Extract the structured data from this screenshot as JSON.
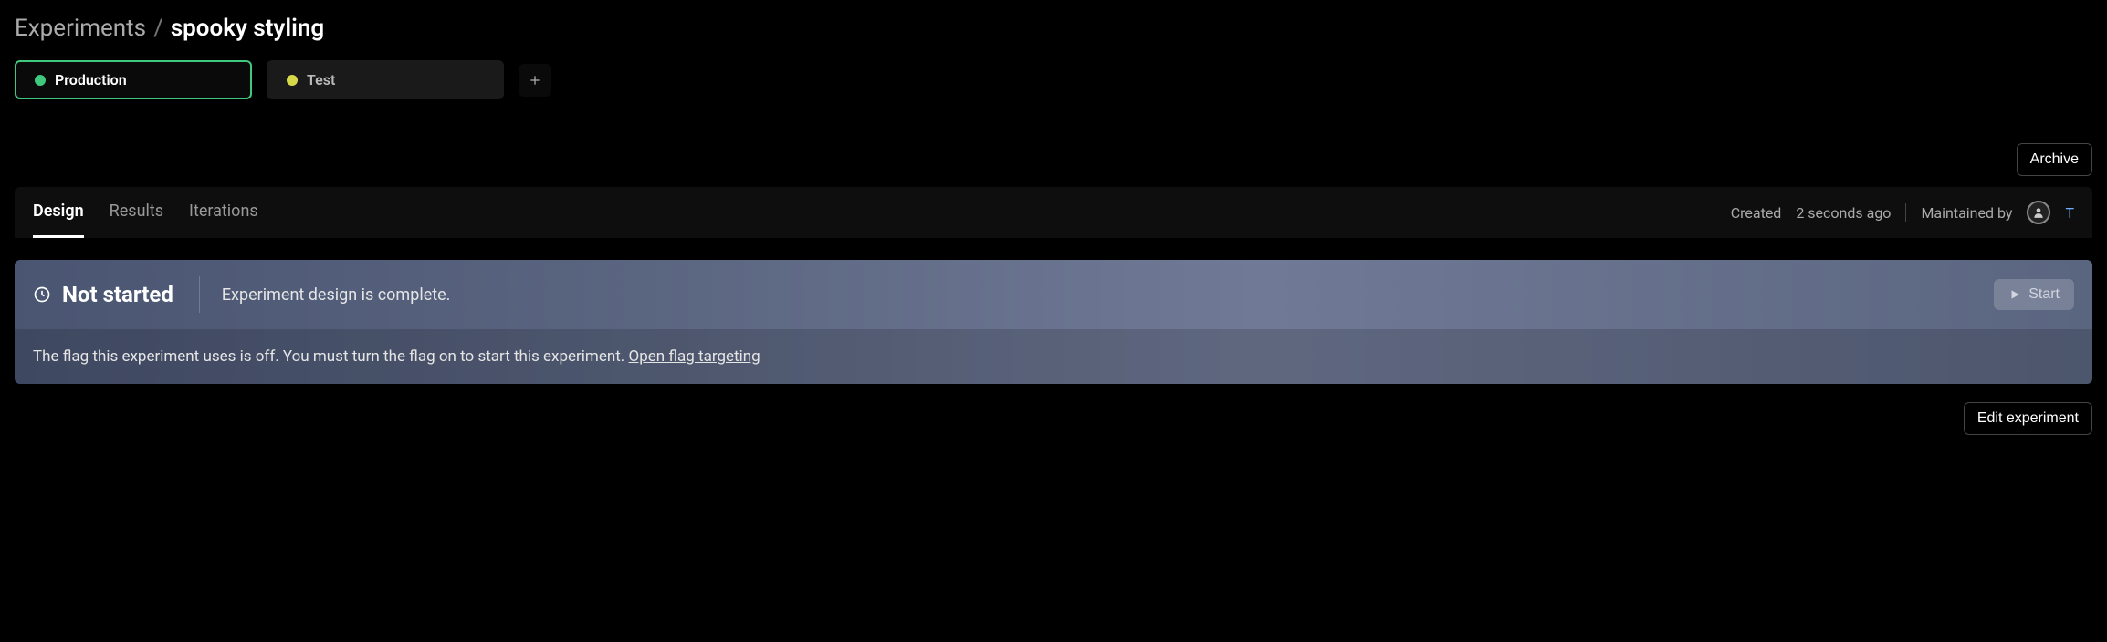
{
  "breadcrumb": {
    "root": "Experiments",
    "sep": "/",
    "current": "spooky styling"
  },
  "environments": {
    "items": [
      {
        "label": "Production",
        "active": true,
        "dot": "green"
      },
      {
        "label": "Test",
        "active": false,
        "dot": "yellow"
      }
    ]
  },
  "topActions": {
    "archive": "Archive"
  },
  "tabs": {
    "items": [
      {
        "label": "Design",
        "active": true
      },
      {
        "label": "Results",
        "active": false
      },
      {
        "label": "Iterations",
        "active": false
      }
    ],
    "meta": {
      "createdLabel": "Created",
      "createdTime": "2 seconds ago",
      "maintainedLabel": "Maintained by",
      "maintainerInitial": "T"
    }
  },
  "status": {
    "title": "Not started",
    "message": "Experiment design is complete.",
    "body": "The flag this experiment uses is off. You must turn the flag on to start this experiment. ",
    "link": "Open flag targeting",
    "startLabel": "Start"
  },
  "actions": {
    "edit": "Edit experiment"
  }
}
